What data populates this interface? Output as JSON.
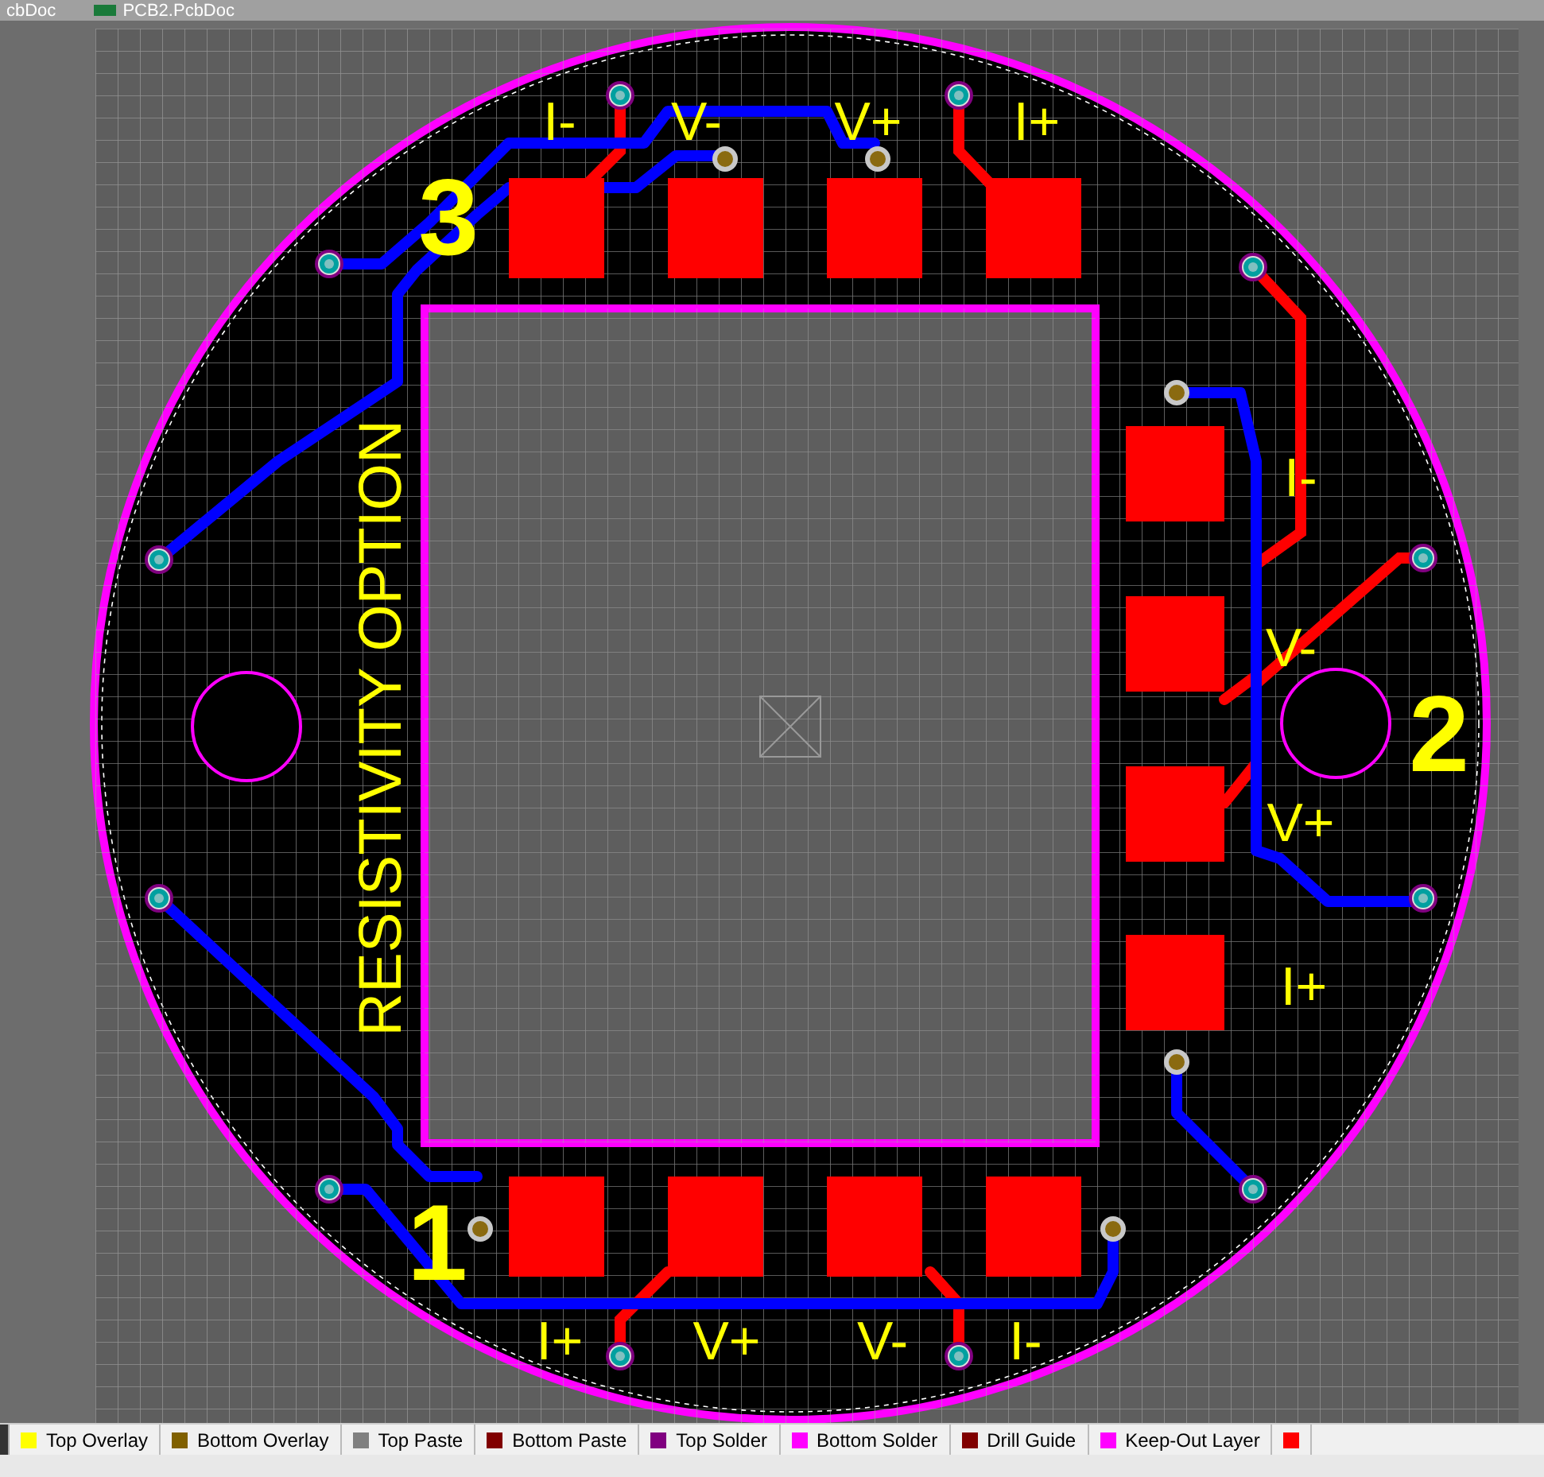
{
  "document_tabs": [
    {
      "label": "cbDoc"
    },
    {
      "label": "PCB2.PcbDoc"
    }
  ],
  "board": {
    "silkscreen_text": "RESISTIVITY OPTION",
    "channel_numbers": [
      "3",
      "2",
      "1"
    ],
    "pad_labels": [
      "I-",
      "V-",
      "V+",
      "I+",
      "I-",
      "V-",
      "V+",
      "I+",
      "I+",
      "V+",
      "V-",
      "I-"
    ]
  },
  "layer_tabs": [
    {
      "label": "Top Overlay",
      "color": "#ffff00"
    },
    {
      "label": "Bottom Overlay",
      "color": "#806000"
    },
    {
      "label": "Top Paste",
      "color": "#808080"
    },
    {
      "label": "Bottom Paste",
      "color": "#800000"
    },
    {
      "label": "Top Solder",
      "color": "#800080"
    },
    {
      "label": "Bottom Solder",
      "color": "#ff00ff"
    },
    {
      "label": "Drill Guide",
      "color": "#800000"
    },
    {
      "label": "Keep-Out Layer",
      "color": "#ff00ff"
    },
    {
      "color": "#ff0000"
    }
  ]
}
